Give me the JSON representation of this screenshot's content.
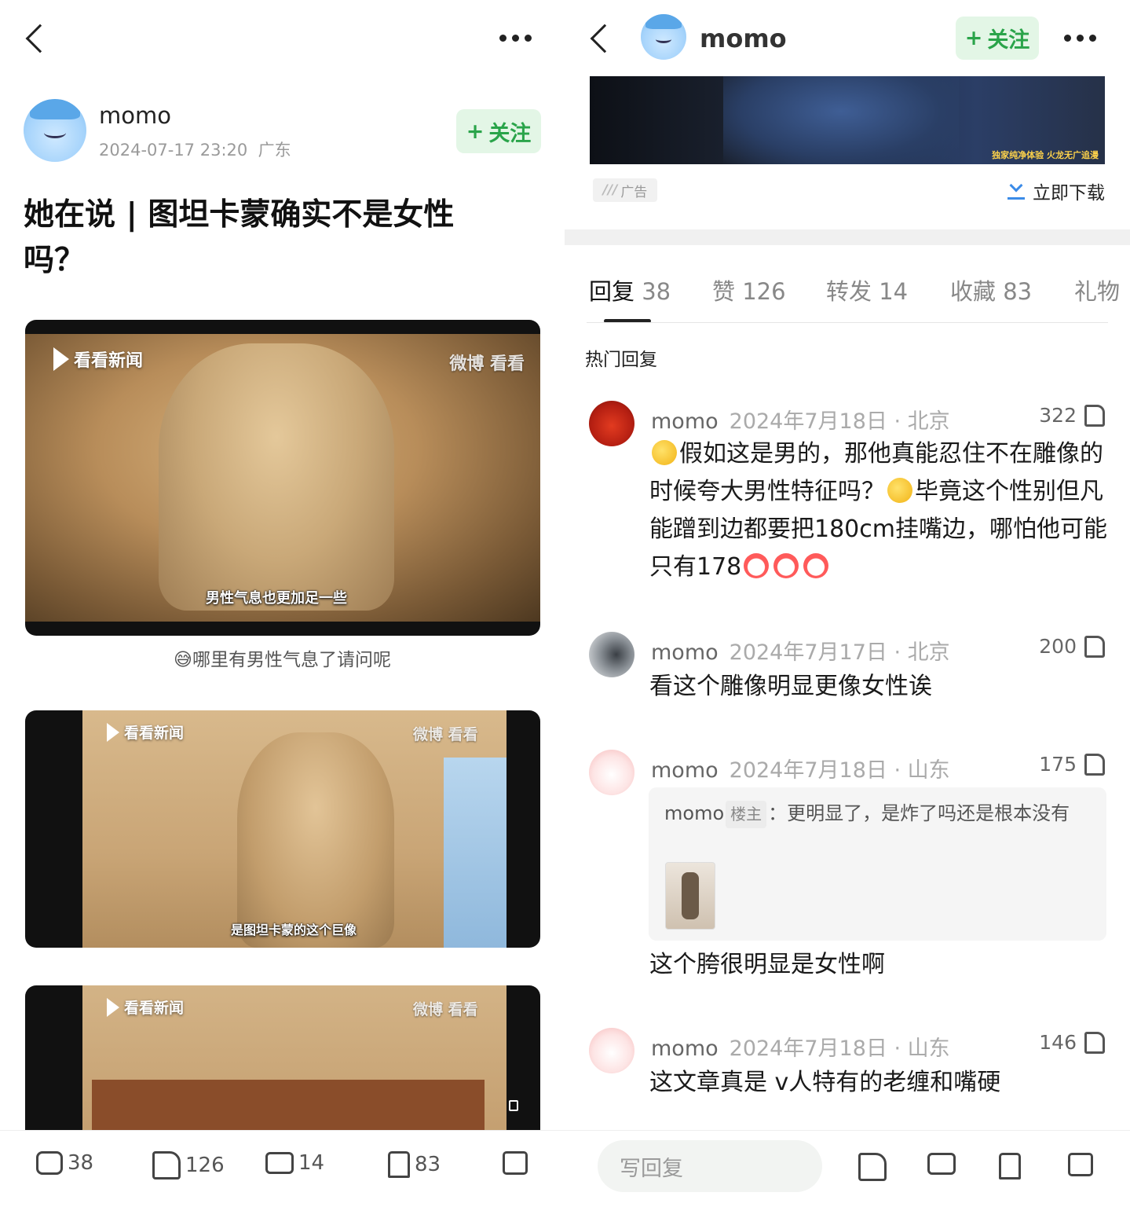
{
  "left": {
    "author": {
      "name": "momo",
      "time": "2024-07-17 23:20",
      "location": "广东"
    },
    "follow_label": "关注",
    "follow_plus": "+",
    "title": "她在说 | 图坦卡蒙确实不是女性吗？",
    "images": [
      {
        "logo": "看看新闻",
        "watermark": "微博 看看",
        "subtitle": "男性气息也更加足一些"
      },
      {
        "logo": "看看新闻",
        "watermark": "微博 看看",
        "subtitle": "是图坦卡蒙的这个巨像"
      },
      {
        "logo": "看看新闻",
        "watermark": "微博 看看",
        "subtitle": ""
      }
    ],
    "caption": "😅哪里有男性气息了请问呢",
    "bottom_bar": {
      "comments": "38",
      "likes": "126",
      "reposts": "14",
      "favorites": "83"
    }
  },
  "right": {
    "header": {
      "name": "momo",
      "follow_label": "关注",
      "follow_plus": "+"
    },
    "ad": {
      "badge": "广告",
      "download": "立即下载",
      "banner_text": "独家纯净体验 火龙无广追漫"
    },
    "tabs": [
      {
        "label": "回复",
        "count": "38"
      },
      {
        "label": "赞",
        "count": "126"
      },
      {
        "label": "转发",
        "count": "14"
      },
      {
        "label": "收藏",
        "count": "83"
      },
      {
        "label": "礼物",
        "count": ""
      }
    ],
    "section_title": "热门回复",
    "comments": [
      {
        "name": "momo",
        "date": "2024年7月18日",
        "location": "北京",
        "likes": "322",
        "text_parts": [
          "假如这是男的，那他真能忍住不在雕像的时候夸大男性特征吗？",
          "毕竟这个性别但凡能蹭到边都要把180cm挂嘴边，哪怕他可能只有178"
        ]
      },
      {
        "name": "momo",
        "date": "2024年7月17日",
        "location": "北京",
        "likes": "200",
        "text": "看这个雕像明显更像女性诶"
      },
      {
        "name": "momo",
        "date": "2024年7月18日",
        "location": "山东",
        "likes": "175",
        "reply": {
          "name": "momo",
          "badge": "楼主",
          "text": "：更明显了，是炸了吗还是根本没有"
        },
        "text": "这个胯很明显是女性啊"
      },
      {
        "name": "momo",
        "date": "2024年7月18日",
        "location": "山东",
        "likes": "146",
        "text": "这文章真是 v人特有的老缠和嘴硬"
      }
    ],
    "bottom": {
      "write_reply": "写回复"
    }
  },
  "colors": {
    "accent_green": "#2aa44a",
    "follow_bg": "#e3f6e6",
    "link_blue": "#3b8be8"
  }
}
